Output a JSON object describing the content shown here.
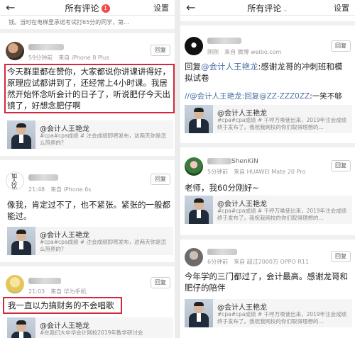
{
  "left": {
    "header": {
      "title": "所有评论",
      "badge": "1",
      "settings": "设置"
    },
    "top_snippet": "钱。当时在电梯里承诺考试打65分的同学，第...",
    "comments": [
      {
        "time": "59分钟前",
        "source": "来自 iPhone 8 Plus",
        "reply": "回复",
        "text": "今天群里都在赞你，大家都说你讲课讲得好，原理应试都讲到了，还经常上4小时课。我居然开始怀念听会计的日子了，听说肥仔今天出镜了，好想念肥仔啊",
        "card": {
          "title": "@会计人王艳龙",
          "desc": "#cpa#cpa成绩 # 注会成绩即将发布，这两天你是怎么煎熬的？"
        }
      },
      {
        "avatar_text": "如人饮水",
        "time": "21:48",
        "source": "来自 iPhone 6s",
        "reply": "回复",
        "text": "像我，肯定过不了，也不紧张。紧张的一般都能过。",
        "card": {
          "title": "@会计人王艳龙",
          "desc": "#cpa#cpa成绩 # 注会成绩即将发布，这两天你是怎么煎熬的？"
        }
      },
      {
        "time": "21:03",
        "source": "来自 华为手机",
        "reply": "回复",
        "text": "我一直以为搞财务的不会唱歌",
        "card": {
          "title": "@会计人王艳龙",
          "desc": "#在我们大中华会计网校2019年教学研讨会"
        }
      }
    ]
  },
  "right": {
    "header": {
      "title": "所有评论",
      "chevron": "⌄",
      "settings": "设置"
    },
    "comments": [
      {
        "time": "刚刚",
        "source": "来自 微博 weibo.com",
        "reply": "回复",
        "text_prefix": "回复",
        "text_mention": "@会计人王艳龙",
        "text_rest": ":感谢龙哥的冲刺班和模拟试卷",
        "quote_mention1": "//@会计人王艳龙",
        "quote_mention2": ":回复@ZZ-ZZZ0ZZ",
        "quote_rest": ":一笑不够",
        "card": {
          "title": "@会计人王艳龙",
          "desc": "#cpa#cpa成绩 # 千呼万唤使出来，2019年注会成绩终于发布了。我祝我网校的你们取得理想的..."
        }
      },
      {
        "name": "ShenKiN",
        "time": "5分钟前",
        "source": "来自 HUAWEI Mate 20 Pro",
        "reply": "回复",
        "text": "老师，我60分刚好~",
        "card": {
          "title": "@会计人王艳龙",
          "desc": "#cpa#cpa成绩 # 千呼万唤使出来，2019年注会成绩终于发布了。我祝我网校的你们取得理想的..."
        }
      },
      {
        "time": "6分钟前",
        "source": "来自 超过2000万 OPPO R11",
        "reply": "回复",
        "text": "今年学的三门都过了，会计最高。感谢龙哥和肥仔的陪伴",
        "card": {
          "title": "@会计人王艳龙",
          "desc": "#cpa#cpa成绩 # 千呼万唤使出来，2019年注会成绩终于发布了。我祝我网校的你们取得理想的..."
        }
      }
    ]
  },
  "colors": {
    "highlight": "#d4283c",
    "badge": "#f24949",
    "mention": "#4a6fa5",
    "chevron": "#f0a33c"
  }
}
